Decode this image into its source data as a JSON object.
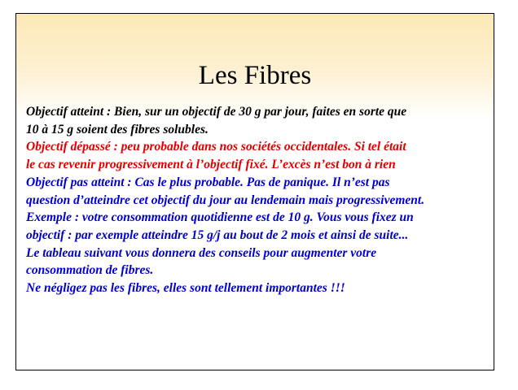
{
  "slide": {
    "title": "Les Fibres",
    "lines": [
      {
        "text": "Objectif atteint : Bien, sur un objectif de 30 g par jour, faites en sorte que",
        "color": "#000000"
      },
      {
        "text": "10 à 15 g soient des fibres solubles.",
        "color": "#000000"
      },
      {
        "text": "Objectif dépassé : peu probable dans nos sociétés occidentales. Si tel était",
        "color": "#e00000"
      },
      {
        "text": "le cas revenir progressivement à l’objectif fixé. L’excès n’est bon à rien",
        "color": "#e00000"
      },
      {
        "text": "Objectif pas atteint : Cas le plus probable. Pas de panique. Il n’est pas",
        "color": "#0000cc"
      },
      {
        "text": "question d’atteindre cet objectif du jour au lendemain mais progressivement.",
        "color": "#0000cc"
      },
      {
        "text": "Exemple : votre consommation quotidienne est de 10 g. Vous vous fixez un",
        "color": "#0000cc"
      },
      {
        "text": "objectif : par exemple atteindre 15 g/j au bout de 2 mois et ainsi de suite...",
        "color": "#0000cc"
      },
      {
        "text": "Le tableau suivant vous donnera des conseils pour augmenter votre",
        "color": "#0000cc"
      },
      {
        "text": "consommation de fibres.",
        "color": "#0000cc"
      },
      {
        "text": "Ne négligez pas les fibres, elles sont tellement importantes !!!",
        "color": "#0000cc"
      }
    ]
  }
}
